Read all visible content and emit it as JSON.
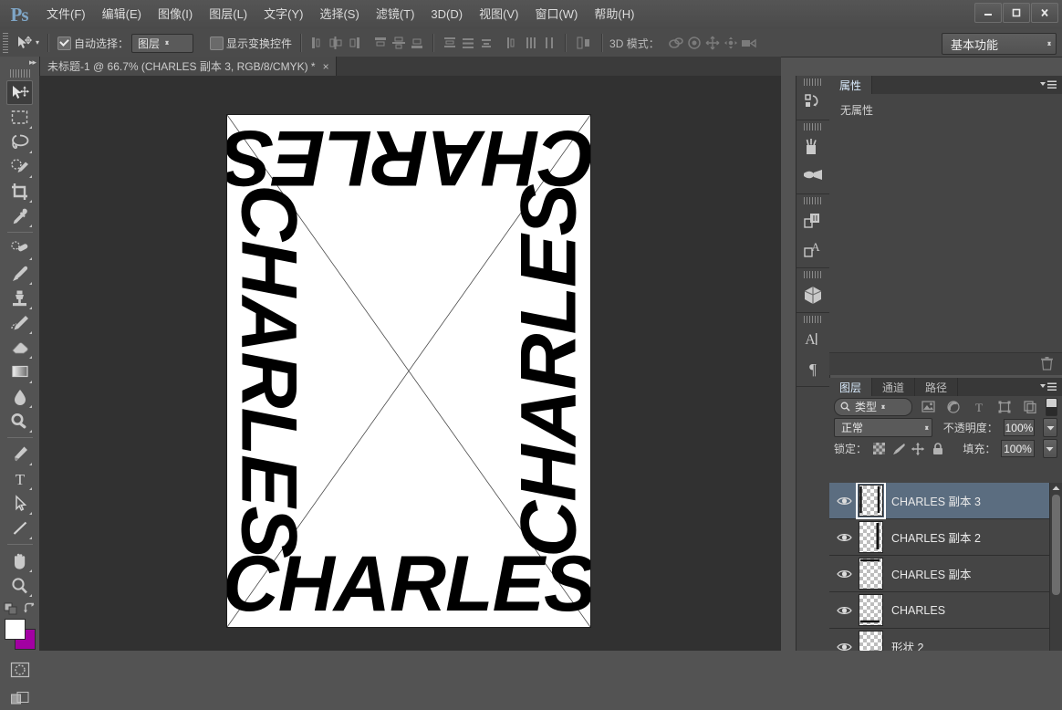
{
  "app": {
    "name": "Ps",
    "window_controls": [
      "minimize",
      "maximize",
      "close"
    ]
  },
  "menubar": {
    "items": [
      {
        "label": "文件(F)",
        "name": "menu-file"
      },
      {
        "label": "编辑(E)",
        "name": "menu-edit"
      },
      {
        "label": "图像(I)",
        "name": "menu-image"
      },
      {
        "label": "图层(L)",
        "name": "menu-layer"
      },
      {
        "label": "文字(Y)",
        "name": "menu-type"
      },
      {
        "label": "选择(S)",
        "name": "menu-select"
      },
      {
        "label": "滤镜(T)",
        "name": "menu-filter"
      },
      {
        "label": "3D(D)",
        "name": "menu-3d"
      },
      {
        "label": "视图(V)",
        "name": "menu-view"
      },
      {
        "label": "窗口(W)",
        "name": "menu-window"
      },
      {
        "label": "帮助(H)",
        "name": "menu-help"
      }
    ]
  },
  "options_bar": {
    "auto_select_checked": true,
    "auto_select_label": "自动选择：",
    "auto_select_value": "图层",
    "show_transform_checked": false,
    "show_transform_label": "显示变换控件",
    "mode_3d_label": "3D 模式：",
    "workspace": "基本功能"
  },
  "document_tab": {
    "title": "未标题-1 @ 66.7% (CHARLES 副本 3, RGB/8/CMYK) *",
    "close": "×"
  },
  "canvas": {
    "artwork_text": "CHARLES",
    "zoom": "66.7%",
    "background": "#ffffff"
  },
  "toolbar": {
    "tools": [
      {
        "name": "move-tool",
        "active": true
      },
      {
        "name": "rectangular-marquee-tool",
        "active": false
      },
      {
        "name": "lasso-tool",
        "active": false
      },
      {
        "name": "quick-selection-tool",
        "active": false
      },
      {
        "name": "crop-tool",
        "active": false
      },
      {
        "name": "eyedropper-tool",
        "active": false
      },
      {
        "name": "healing-brush-tool",
        "active": false
      },
      {
        "name": "brush-tool",
        "active": false
      },
      {
        "name": "clone-stamp-tool",
        "active": false
      },
      {
        "name": "history-brush-tool",
        "active": false
      },
      {
        "name": "eraser-tool",
        "active": false
      },
      {
        "name": "gradient-tool",
        "active": false
      },
      {
        "name": "blur-tool",
        "active": false
      },
      {
        "name": "dodge-tool",
        "active": false
      },
      {
        "name": "pen-tool",
        "active": false
      },
      {
        "name": "type-tool",
        "active": false
      },
      {
        "name": "path-selection-tool",
        "active": false
      },
      {
        "name": "line-tool",
        "active": false
      },
      {
        "name": "hand-tool",
        "active": false
      },
      {
        "name": "zoom-tool",
        "active": false
      }
    ],
    "foreground_color": "#ffffff",
    "background_color": "#a200a2"
  },
  "properties_panel": {
    "tabs": [
      {
        "label": "属性",
        "active": true
      }
    ],
    "empty_message": "无属性"
  },
  "layers_panel": {
    "tabs": [
      {
        "label": "图层",
        "active": true
      },
      {
        "label": "通道",
        "active": false
      },
      {
        "label": "路径",
        "active": false
      }
    ],
    "filter_type": "类型",
    "blend_mode": "正常",
    "opacity_label": "不透明度：",
    "opacity_value": "100%",
    "lock_label": "锁定：",
    "fill_label": "填充：",
    "fill_value": "100%",
    "layers": [
      {
        "name": "CHARLES 副本 3",
        "visible": true,
        "selected": true
      },
      {
        "name": "CHARLES 副本 2",
        "visible": true,
        "selected": false
      },
      {
        "name": "CHARLES 副本",
        "visible": true,
        "selected": false
      },
      {
        "name": "CHARLES",
        "visible": true,
        "selected": false
      },
      {
        "name": "形状 2",
        "visible": true,
        "selected": false
      }
    ]
  },
  "colors": {
    "menu_bg": "#4f4f4f",
    "panel_bg": "#454545",
    "canvas_bg": "#313131",
    "selection_blue": "#5b6d80",
    "accent_text": "#7fa6c7"
  }
}
